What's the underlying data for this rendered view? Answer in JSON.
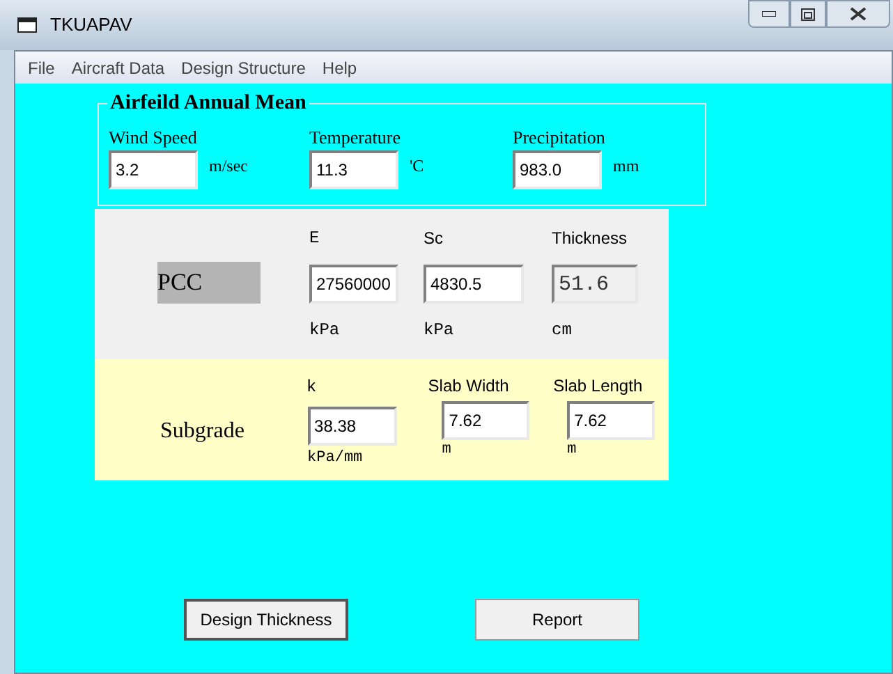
{
  "window": {
    "title": "TKUAPAV"
  },
  "menu": [
    "File",
    "Aircraft Data",
    "Design Structure",
    "Help"
  ],
  "airfield": {
    "title": "Airfeild Annual Mean",
    "fields": [
      {
        "label": "Wind Speed",
        "value": "3.2",
        "unit": "m/sec"
      },
      {
        "label": "Temperature",
        "value": "11.3",
        "unit": "'C"
      },
      {
        "label": "Precipitation",
        "value": "983.0",
        "unit": "mm"
      }
    ]
  },
  "pcc": {
    "label": "PCC",
    "fields": [
      {
        "label": "E",
        "value": "27560000",
        "unit": "kPa",
        "read_only": false
      },
      {
        "label": "Sc",
        "value": "4830.5",
        "unit": "kPa",
        "read_only": false
      },
      {
        "label": "Thickness",
        "value": "51.6",
        "unit": "cm",
        "read_only": true
      }
    ]
  },
  "subgrade": {
    "label": "Subgrade",
    "fields": [
      {
        "label": "k",
        "value": "38.38",
        "unit": "kPa/mm"
      },
      {
        "label": "Slab Width",
        "value": "7.62",
        "unit": "m"
      },
      {
        "label": "Slab Length",
        "value": "7.62",
        "unit": "m"
      }
    ]
  },
  "buttons": [
    {
      "label": "Design Thickness",
      "focused": true
    },
    {
      "label": "Report",
      "focused": false
    }
  ]
}
